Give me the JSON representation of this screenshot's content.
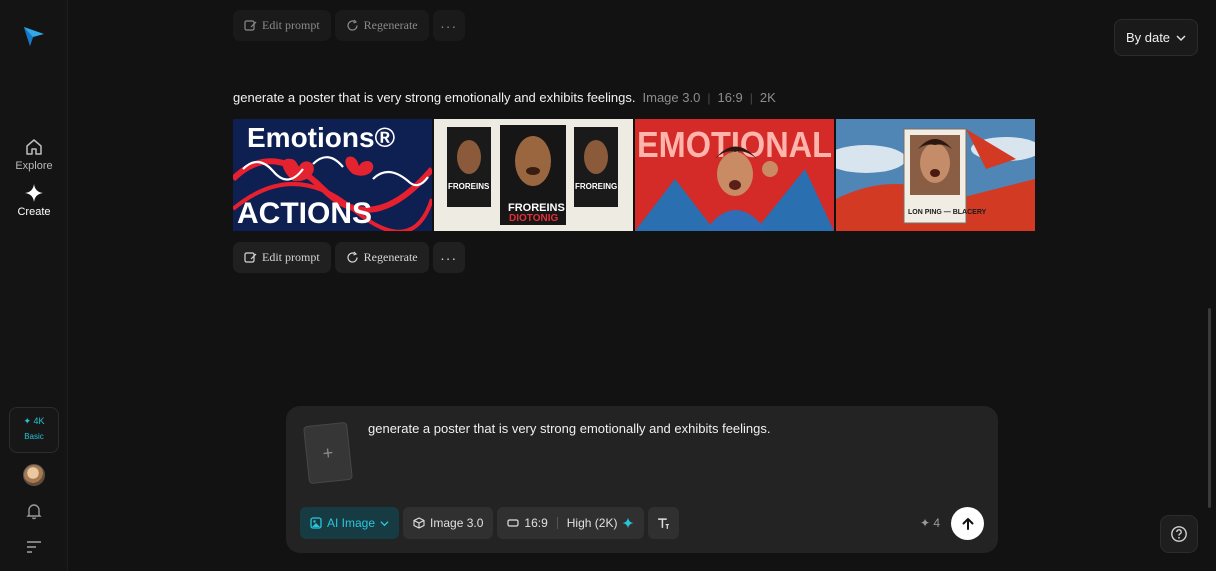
{
  "sidebar": {
    "items": [
      {
        "label": "Explore",
        "icon": "home-icon"
      },
      {
        "label": "Create",
        "icon": "sparkle-icon"
      }
    ],
    "credits": {
      "amount": "✦ 4K",
      "plan": "Basic"
    }
  },
  "sort": {
    "label": "By date"
  },
  "previous_actions": {
    "edit": "Edit prompt",
    "regenerate": "Regenerate",
    "more": "···"
  },
  "generation": {
    "prompt": "generate a poster that is very strong emotionally and exhibits feelings.",
    "model": "Image 3.0",
    "ratio": "16:9",
    "resolution": "2K",
    "images": [
      {
        "caption_top": "Emotions®",
        "caption_bottom": "ACTIONS"
      },
      {
        "caption_top": "FROREINS",
        "caption_bottom": "DIOTONIG",
        "side_caption": "FROREING"
      },
      {
        "caption_top": "EMOTIONAL"
      },
      {
        "caption_top": "LON PING — BLACERY"
      }
    ],
    "actions": {
      "edit": "Edit prompt",
      "regenerate": "Regenerate",
      "more": "···"
    }
  },
  "composer": {
    "text": "generate a poster that is very strong emotionally and exhibits feelings.",
    "upload_symbol": "+",
    "mode": "AI Image",
    "model": "Image 3.0",
    "ratio": "16:9",
    "quality": "High (2K)",
    "cost": "✦ 4"
  },
  "colors": {
    "accent": "#27c3d6",
    "background": "#121212",
    "panel": "#232323"
  }
}
